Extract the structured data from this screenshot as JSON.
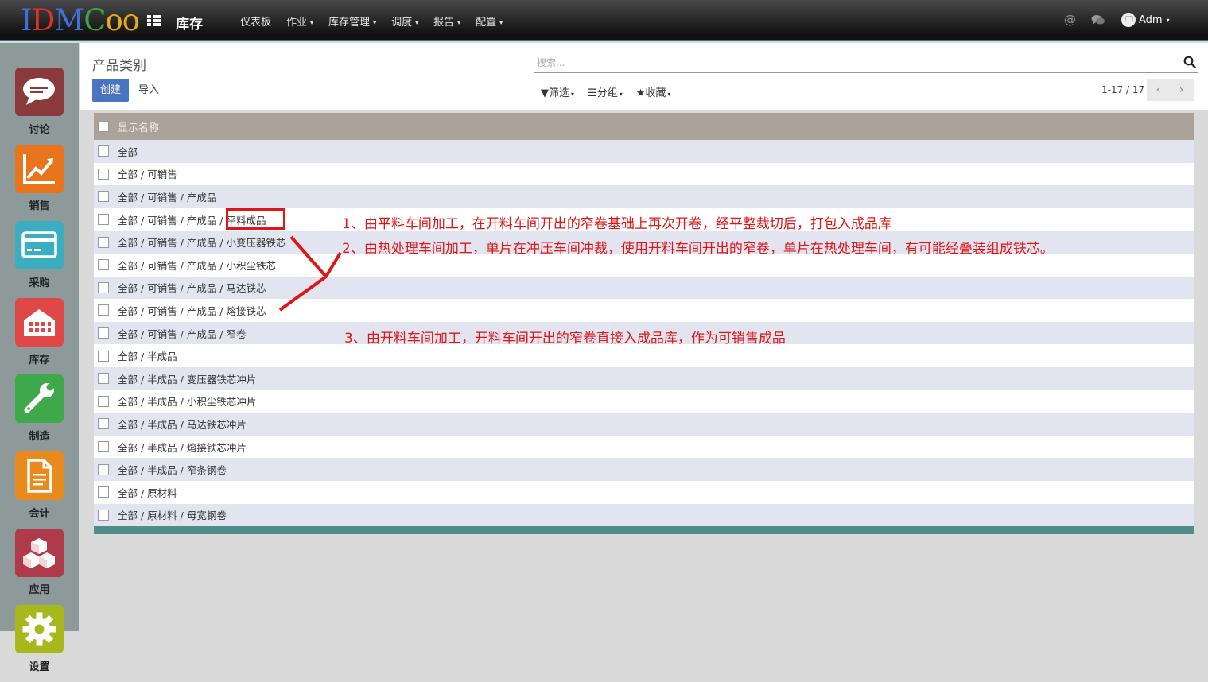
{
  "topbar": {
    "logo_letters": [
      "I",
      "D",
      "M",
      "C",
      "oo"
    ],
    "app_title": "库存",
    "menu": [
      {
        "label": "仪表板",
        "has_caret": false
      },
      {
        "label": "作业",
        "has_caret": true
      },
      {
        "label": "库存管理",
        "has_caret": true
      },
      {
        "label": "调度",
        "has_caret": true
      },
      {
        "label": "报告",
        "has_caret": true
      },
      {
        "label": "配置",
        "has_caret": true
      }
    ],
    "at_symbol": "@",
    "user_name": "Adm",
    "caret": "▾"
  },
  "sidebar": {
    "items": [
      {
        "label": "讨论",
        "icon": "chat-bubble-icon",
        "color": "#8a3a3a"
      },
      {
        "label": "销售",
        "icon": "trend-chart-icon",
        "color": "#e8741c"
      },
      {
        "label": "采购",
        "icon": "credit-card-icon",
        "color": "#3aaec0"
      },
      {
        "label": "库存",
        "icon": "warehouse-icon",
        "color": "#e04848"
      },
      {
        "label": "制造",
        "icon": "wrench-icon",
        "color": "#3ea84a"
      },
      {
        "label": "会计",
        "icon": "document-icon",
        "color": "#e88a1c"
      },
      {
        "label": "应用",
        "icon": "cubes-icon",
        "color": "#b03a4a"
      },
      {
        "label": "设置",
        "icon": "gear-icon",
        "color": "#a8b81c"
      }
    ]
  },
  "control_panel": {
    "breadcrumb": "产品类别",
    "search_placeholder": "搜索...",
    "create_label": "创建",
    "import_label": "导入",
    "filter_label": "筛选",
    "group_label": "分组",
    "favorites_label": "收藏",
    "pager_text": "1-17 / 17",
    "pager_prev": "‹",
    "pager_next": "›"
  },
  "table": {
    "header": "显示名称",
    "rows": [
      "全部",
      "全部 / 可销售",
      "全部 / 可销售 / 产成品",
      "全部 / 可销售 / 产成品 / 平料成品",
      "全部 / 可销售 / 产成品 / 小变压器铁芯",
      "全部 / 可销售 / 产成品 / 小积尘铁芯",
      "全部 / 可销售 / 产成品 / 马达铁芯",
      "全部 / 可销售 / 产成品 / 熔接铁芯",
      "全部 / 可销售 / 产成品 / 窄卷",
      "全部 / 半成品",
      "全部 / 半成品 / 变压器铁芯冲片",
      "全部 / 半成品 / 小积尘铁芯冲片",
      "全部 / 半成品 / 马达铁芯冲片",
      "全部 / 半成品 / 熔接铁芯冲片",
      "全部 / 半成品 / 窄条钢卷",
      "全部 / 原材料",
      "全部 / 原材料 / 母宽钢卷"
    ]
  },
  "annotations": {
    "note1": "1、由平料车间加工，在开料车间开出的窄卷基础上再次开卷，经平整裁切后，打包入成品库",
    "note2": "2、由热处理车间加工，单片在冲压车间冲裁，使用开料车间开出的窄卷，单片在热处理车间，有可能经叠装组成铁芯。",
    "note3": "3、由开料车间加工，开料车间开出的窄卷直接入成品库，作为可销售成品",
    "color": "#e01515"
  }
}
